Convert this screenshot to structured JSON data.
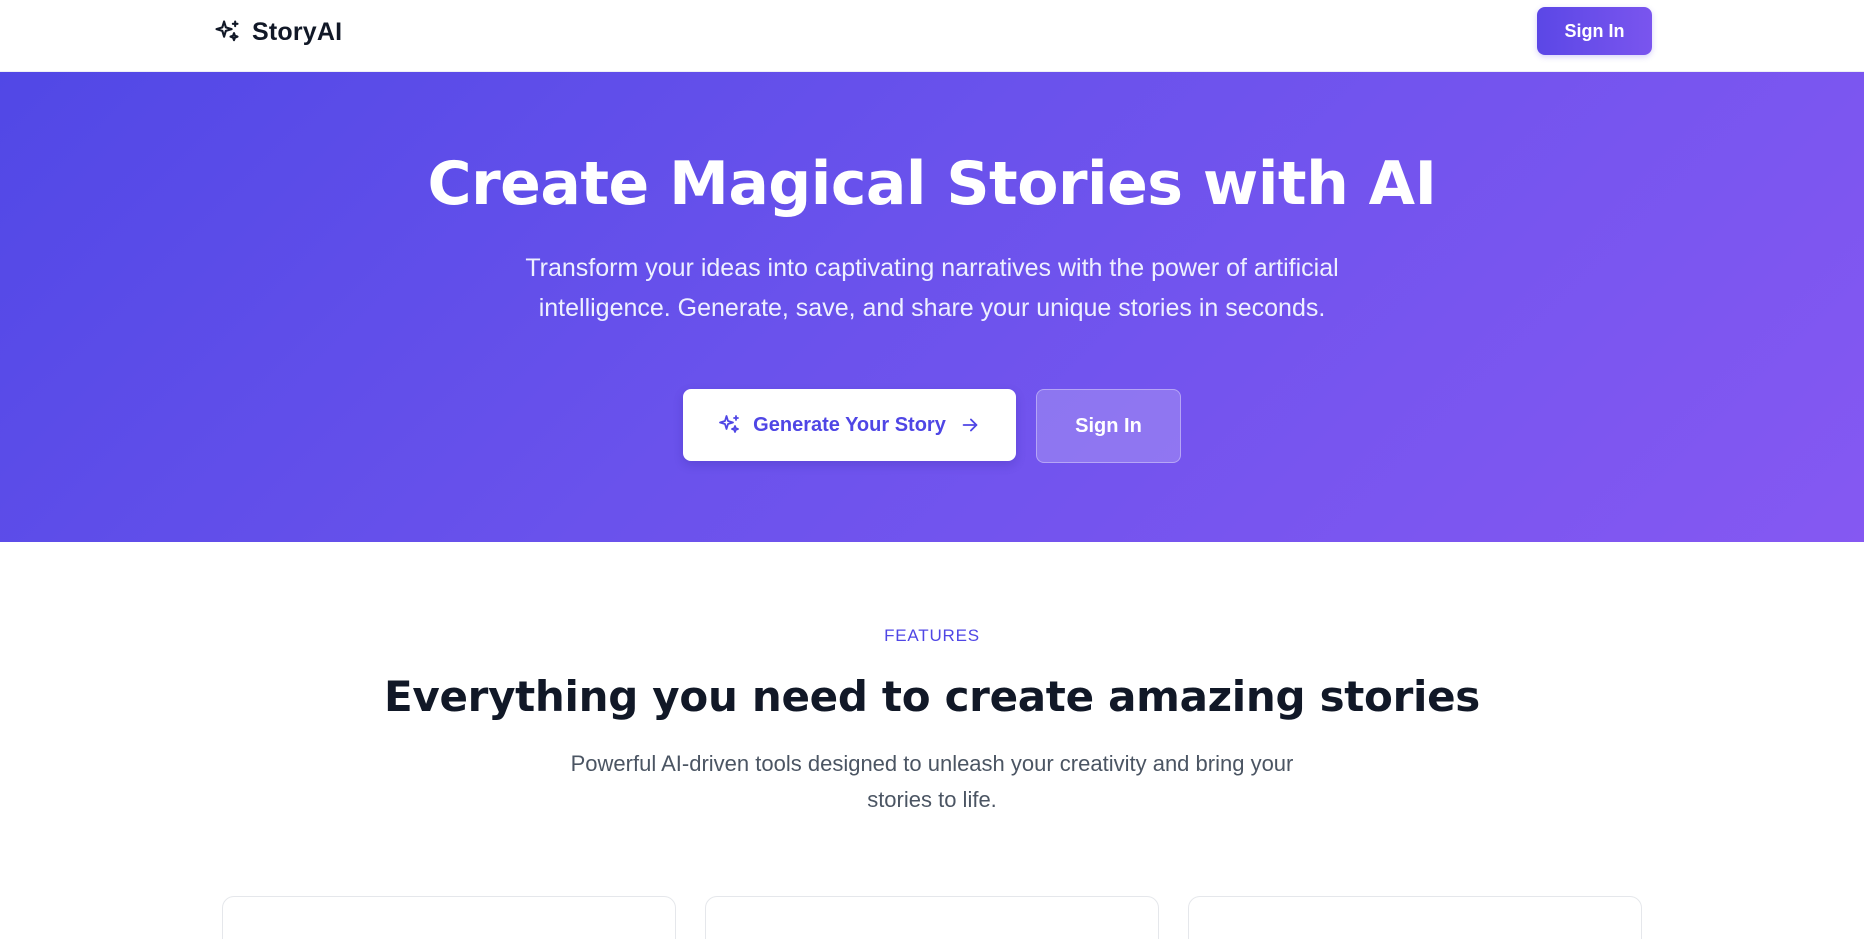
{
  "header": {
    "brand_name": "StoryAI",
    "brand_icon": "sparkles-icon",
    "signin_label": "Sign In"
  },
  "hero": {
    "title": "Create Magical Stories with AI",
    "subtitle": "Transform your ideas into captivating narratives with the power of artificial intelligence. Generate, save, and share your unique stories in seconds.",
    "primary_cta": {
      "label": "Generate Your Story",
      "leading_icon": "sparkles-icon",
      "trailing_icon": "arrow-right-icon"
    },
    "secondary_cta": {
      "label": "Sign In"
    }
  },
  "features": {
    "eyebrow": "FEATURES",
    "title": "Everything you need to create amazing stories",
    "subtitle": "Powerful AI-driven tools designed to unleash your creativity and bring your stories to life."
  },
  "colors": {
    "accent": "#4f46e5",
    "gradient_start": "#5148e6",
    "gradient_end": "#8558f2",
    "heading": "#111827",
    "body_text": "#4b5563"
  }
}
